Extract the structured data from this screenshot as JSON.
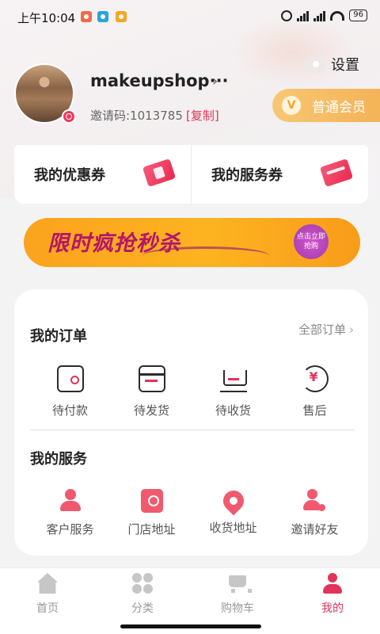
{
  "status_bar": {
    "time": "上午10:04",
    "battery": "96",
    "app_icons": [
      "taobao-icon",
      "telegram-icon",
      "weibo-icon"
    ]
  },
  "profile": {
    "username": "makeupshop···",
    "invite_label": "邀请码:1013785",
    "copy_label": "[复制]"
  },
  "settings_label": "设置",
  "member_label": "普通会员",
  "member_icon_glyph": "V",
  "coupons": {
    "my_coupons": "我的优惠券",
    "my_service_coupons": "我的服务券"
  },
  "banner": {
    "title": "限时疯抢秒杀",
    "badge": "点击立即抢购"
  },
  "orders": {
    "title": "我的订单",
    "all_label": "全部订单",
    "items": [
      {
        "label": "待付款",
        "icon": "wallet-icon"
      },
      {
        "label": "待发货",
        "icon": "box-icon"
      },
      {
        "label": "待收货",
        "icon": "cart-icon"
      },
      {
        "label": "售后",
        "icon": "after-sales-icon"
      }
    ]
  },
  "services": {
    "title": "我的服务",
    "items": [
      {
        "label": "客户服务",
        "icon": "customer-service-icon"
      },
      {
        "label": "门店地址",
        "icon": "store-address-icon"
      },
      {
        "label": "收货地址",
        "icon": "location-pin-icon"
      },
      {
        "label": "邀请好友",
        "icon": "invite-friend-icon"
      }
    ]
  },
  "tabbar": {
    "items": [
      {
        "label": "首页",
        "icon": "home-icon"
      },
      {
        "label": "分类",
        "icon": "category-icon"
      },
      {
        "label": "购物车",
        "icon": "shopping-cart-icon"
      },
      {
        "label": "我的",
        "icon": "profile-icon"
      }
    ],
    "active": "我的"
  },
  "colors": {
    "accent": "#e0345a",
    "member_gold": "#f3b154",
    "banner_orange": "#fdb320"
  }
}
